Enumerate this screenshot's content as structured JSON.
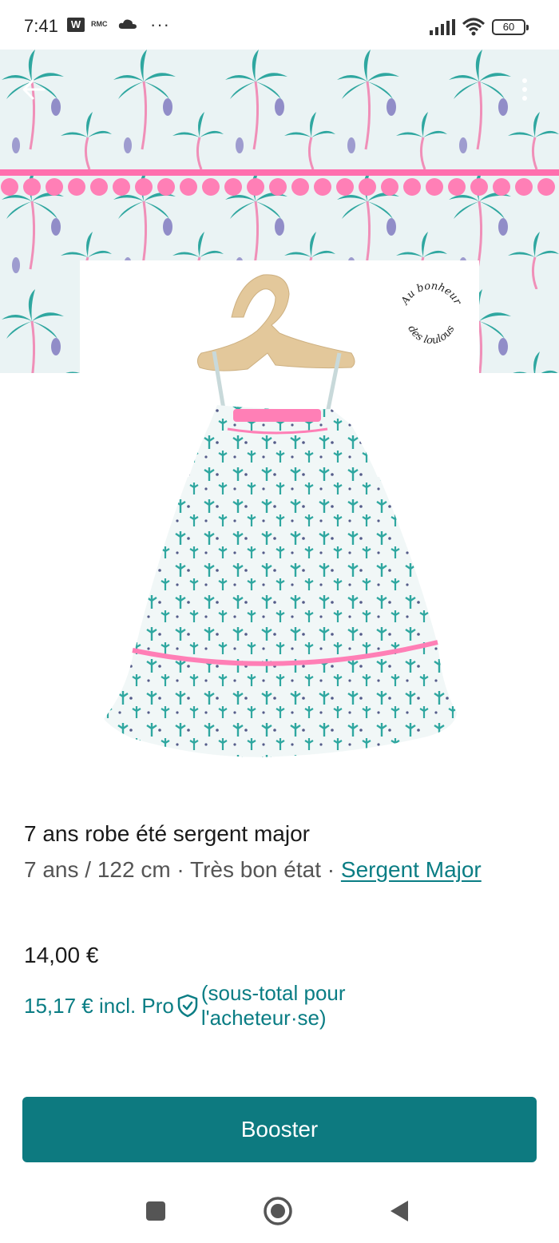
{
  "status_bar": {
    "time": "7:41",
    "w_badge": "W",
    "rmc_badge": "RMC",
    "more_indicator": "···",
    "battery": "60",
    "icons": [
      "w-app-icon",
      "rmc-app-icon",
      "cloud-icon",
      "signal-icon",
      "wifi-icon",
      "battery-icon"
    ]
  },
  "photo": {
    "watermark_top": "Au bonheur",
    "watermark_bottom": "des loulous",
    "colors": {
      "fabric_bg": "#e9f3f3",
      "palm": "#2fa7a0",
      "pom_pom": "#ff6fae",
      "hanger": "#e3c89b"
    }
  },
  "header": {
    "back_icon": "arrow-left-icon",
    "more_icon": "more-vertical-icon"
  },
  "product": {
    "title": "7 ans robe été sergent major",
    "size": "7 ans / 122 cm",
    "separator_1": " · ",
    "condition": "Très bon état",
    "separator_2": " · ",
    "brand": "Sergent Major",
    "price": "14,00 €",
    "buyer_price": "15,17 € incl. Pro",
    "buyer_note": "(sous-total pour l'acheteur·se)"
  },
  "actions": {
    "boost_label": "Booster",
    "accent_color": "#0d7a80"
  },
  "nav": {
    "icons": [
      "recents-square-icon",
      "home-circle-icon",
      "back-triangle-icon"
    ]
  }
}
